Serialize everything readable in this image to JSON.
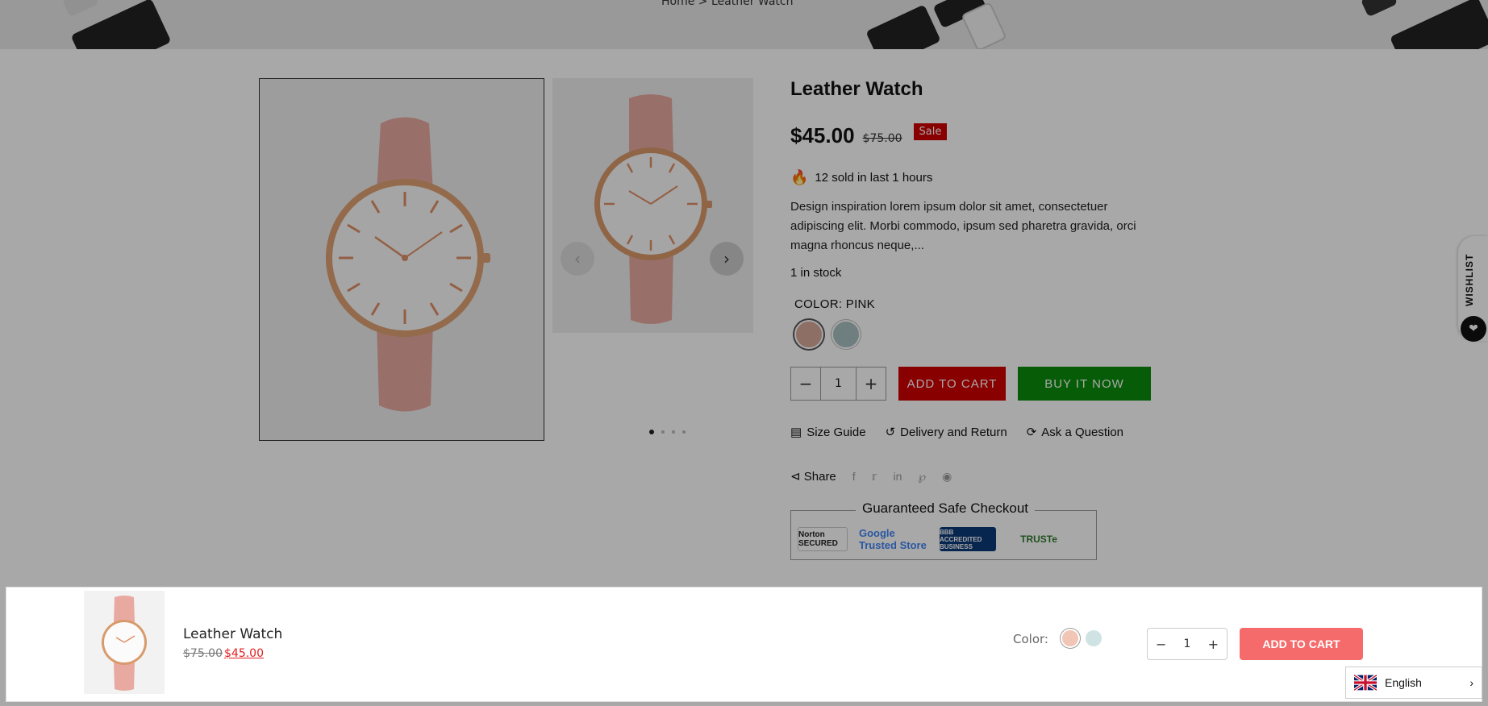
{
  "breadcrumb": "Home  >  Leather Watch",
  "product": {
    "title": "Leather Watch",
    "price_now": "$45.00",
    "price_old": "$75.00",
    "sale_badge": "Sale",
    "sold_text": "12 sold in last 1 hours",
    "description": "Design inspiration lorem ipsum dolor sit amet, consectetuer adipiscing elit. Morbi commodo, ipsum sed pharetra gravida, orci magna rhoncus neque,...",
    "stock": "1 in stock",
    "color_label": "COLOR: PINK",
    "swatches": [
      "#d8a99a",
      "#a9c1c3"
    ],
    "quantity": "1",
    "add_to_cart": "ADD TO CART",
    "buy_now": "BUY IT NOW",
    "links": {
      "size_guide": "Size Guide",
      "delivery": "Delivery and Return",
      "ask": "Ask a Question"
    },
    "share_label": "Share",
    "checkout_title": "Guaranteed Safe Checkout",
    "trust_badges": [
      "Norton SECURED",
      "Google Trusted Store",
      "BBB ACCREDITED BUSINESS",
      "TRUSTe"
    ]
  },
  "wishlist": "WISHLIST",
  "sticky": {
    "title": "Leather Watch",
    "price_old": "$75.00",
    "price_now": "$45.00",
    "color_label": "Color:",
    "quantity": "1",
    "add_to_cart": "ADD TO CART"
  },
  "language": "English",
  "colors": {
    "sale_red": "#d10000",
    "buy_green": "#0c8d0c",
    "sticky_cart": "#f56b6b"
  }
}
